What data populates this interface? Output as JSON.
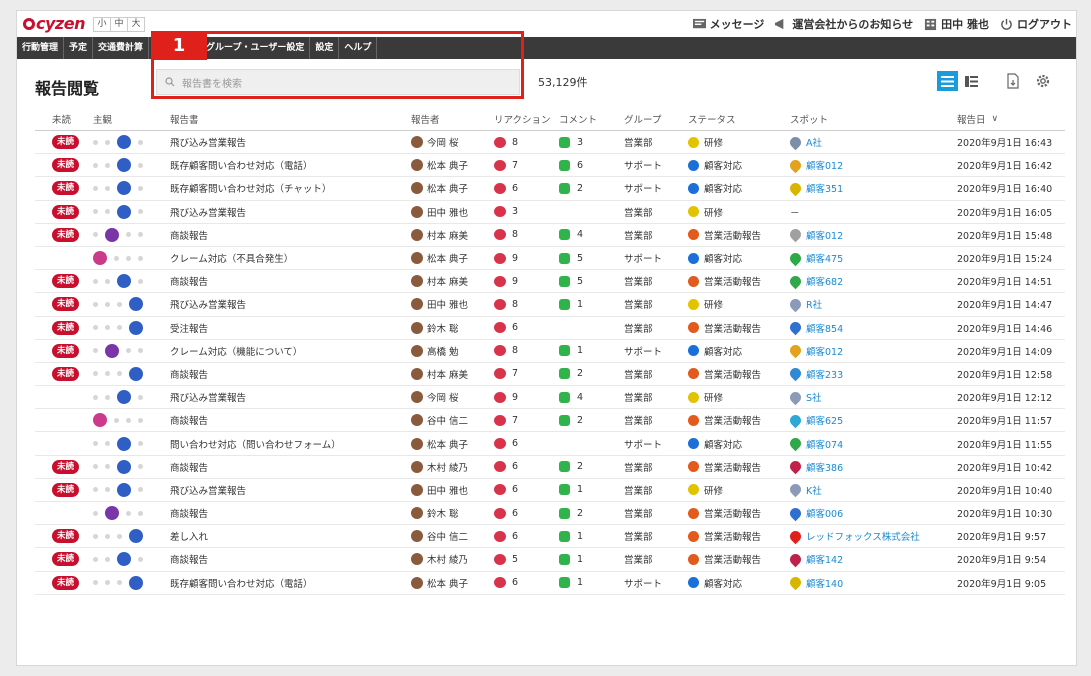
{
  "app": {
    "logo": "cyzen"
  },
  "font_sizes": [
    "小",
    "中",
    "大"
  ],
  "top_links": {
    "messages": "メッセージ",
    "notice": "運営会社からのお知らせ",
    "user": "田中 雅也",
    "logout": "ログアウト"
  },
  "nav": [
    "行動管理",
    "予定",
    "交通費計算",
    "",
    "グループ・ユーザー設定",
    "設定",
    "ヘルプ"
  ],
  "page": {
    "title": "報告閲覧",
    "search_placeholder": "報告書を検索",
    "count": "53,129件",
    "annotation_label": "1"
  },
  "columns": {
    "unread": "未読",
    "subjective": "主観",
    "report": "報告書",
    "reporter": "報告者",
    "reaction": "リアクション",
    "comment": "コメント",
    "group": "グループ",
    "status": "ステータス",
    "spot": "スポット",
    "date": "報告日"
  },
  "status_colors": {
    "研修": "#e3c200",
    "顧客対応": "#1b6fd8",
    "営業活動報告": "#e25a1c"
  },
  "rows": [
    {
      "unread": "未読",
      "mood": 3,
      "title": "飛び込み営業報告",
      "reporter": "今岡 桜",
      "reaction": "8",
      "comment": "3",
      "group": "営業部",
      "status": "研修",
      "spot": "A社",
      "date": "2020年9月1日 16:43"
    },
    {
      "unread": "未読",
      "mood": 3,
      "title": "既存顧客問い合わせ対応（電話）",
      "reporter": "松本 典子",
      "reaction": "7",
      "comment": "6",
      "group": "サポート",
      "status": "顧客対応",
      "spot": "顧客012",
      "date": "2020年9月1日 16:42"
    },
    {
      "unread": "未読",
      "mood": 3,
      "title": "既存顧客問い合わせ対応（チャット）",
      "reporter": "松本 典子",
      "reaction": "6",
      "comment": "2",
      "group": "サポート",
      "status": "顧客対応",
      "spot": "顧客351",
      "date": "2020年9月1日 16:40"
    },
    {
      "unread": "未読",
      "mood": 3,
      "title": "飛び込み営業報告",
      "reporter": "田中 雅也",
      "reaction": "3",
      "comment": "",
      "group": "営業部",
      "status": "研修",
      "spot": "－",
      "date": "2020年9月1日 16:05"
    },
    {
      "unread": "未読",
      "mood": 2,
      "title": "商談報告",
      "reporter": "村本 麻美",
      "reaction": "8",
      "comment": "4",
      "group": "営業部",
      "status": "営業活動報告",
      "spot": "顧客012",
      "date": "2020年9月1日 15:48"
    },
    {
      "unread": "",
      "mood": 1,
      "title": "クレーム対応（不具合発生）",
      "reporter": "松本 典子",
      "reaction": "9",
      "comment": "5",
      "group": "サポート",
      "status": "顧客対応",
      "spot": "顧客475",
      "date": "2020年9月1日 15:24"
    },
    {
      "unread": "未読",
      "mood": 3,
      "title": "商談報告",
      "reporter": "村本 麻美",
      "reaction": "9",
      "comment": "5",
      "group": "営業部",
      "status": "営業活動報告",
      "spot": "顧客682",
      "date": "2020年9月1日 14:51"
    },
    {
      "unread": "未読",
      "mood": 4,
      "title": "飛び込み営業報告",
      "reporter": "田中 雅也",
      "reaction": "8",
      "comment": "1",
      "group": "営業部",
      "status": "研修",
      "spot": "R社",
      "date": "2020年9月1日 14:47"
    },
    {
      "unread": "未読",
      "mood": 4,
      "title": "受注報告",
      "reporter": "鈴木 聡",
      "reaction": "6",
      "comment": "",
      "group": "営業部",
      "status": "営業活動報告",
      "spot": "顧客854",
      "date": "2020年9月1日 14:46"
    },
    {
      "unread": "未読",
      "mood": 2,
      "title": "クレーム対応（機能について）",
      "reporter": "高橋 勉",
      "reaction": "8",
      "comment": "1",
      "group": "サポート",
      "status": "顧客対応",
      "spot": "顧客012",
      "date": "2020年9月1日 14:09"
    },
    {
      "unread": "未読",
      "mood": 4,
      "title": "商談報告",
      "reporter": "村本 麻美",
      "reaction": "7",
      "comment": "2",
      "group": "営業部",
      "status": "営業活動報告",
      "spot": "顧客233",
      "date": "2020年9月1日 12:58"
    },
    {
      "unread": "",
      "mood": 3,
      "title": "飛び込み営業報告",
      "reporter": "今岡 桜",
      "reaction": "9",
      "comment": "4",
      "group": "営業部",
      "status": "研修",
      "spot": "S社",
      "date": "2020年9月1日 12:12"
    },
    {
      "unread": "",
      "mood": 1,
      "title": "商談報告",
      "reporter": "谷中 信二",
      "reaction": "7",
      "comment": "2",
      "group": "営業部",
      "status": "営業活動報告",
      "spot": "顧客625",
      "date": "2020年9月1日 11:57"
    },
    {
      "unread": "",
      "mood": 3,
      "title": "問い合わせ対応（問い合わせフォーム）",
      "reporter": "松本 典子",
      "reaction": "6",
      "comment": "",
      "group": "サポート",
      "status": "顧客対応",
      "spot": "顧客074",
      "date": "2020年9月1日 11:55"
    },
    {
      "unread": "未読",
      "mood": 3,
      "title": "商談報告",
      "reporter": "木村 綾乃",
      "reaction": "6",
      "comment": "2",
      "group": "営業部",
      "status": "営業活動報告",
      "spot": "顧客386",
      "date": "2020年9月1日 10:42"
    },
    {
      "unread": "未読",
      "mood": 3,
      "title": "飛び込み営業報告",
      "reporter": "田中 雅也",
      "reaction": "6",
      "comment": "1",
      "group": "営業部",
      "status": "研修",
      "spot": "K社",
      "date": "2020年9月1日 10:40"
    },
    {
      "unread": "",
      "mood": 2,
      "title": "商談報告",
      "reporter": "鈴木 聡",
      "reaction": "6",
      "comment": "2",
      "group": "営業部",
      "status": "営業活動報告",
      "spot": "顧客006",
      "date": "2020年9月1日 10:30"
    },
    {
      "unread": "未読",
      "mood": 4,
      "title": "差し入れ",
      "reporter": "谷中 信二",
      "reaction": "6",
      "comment": "1",
      "group": "営業部",
      "status": "営業活動報告",
      "spot": "レッドフォックス株式会社",
      "date": "2020年9月1日 9:57"
    },
    {
      "unread": "未読",
      "mood": 3,
      "title": "商談報告",
      "reporter": "木村 綾乃",
      "reaction": "5",
      "comment": "1",
      "group": "営業部",
      "status": "営業活動報告",
      "spot": "顧客142",
      "date": "2020年9月1日 9:54"
    },
    {
      "unread": "未読",
      "mood": 4,
      "title": "既存顧客問い合わせ対応（電話）",
      "reporter": "松本 典子",
      "reaction": "6",
      "comment": "1",
      "group": "サポート",
      "status": "顧客対応",
      "spot": "顧客140",
      "date": "2020年9月1日 9:05"
    }
  ]
}
